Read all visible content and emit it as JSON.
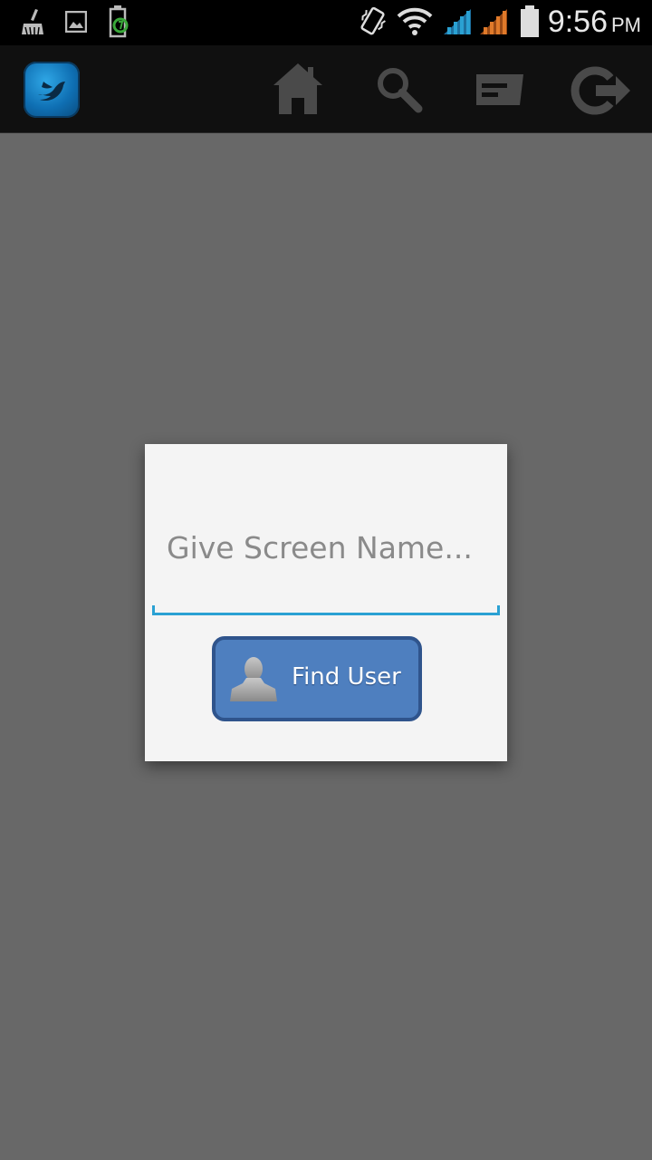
{
  "status_bar": {
    "time": "9:56",
    "ampm": "PM",
    "icons": [
      "cleaner-icon",
      "image-icon",
      "battery-charging-icon",
      "vibrate-icon",
      "wifi-icon",
      "signal-blue-icon",
      "signal-orange-icon",
      "battery-icon"
    ]
  },
  "action_bar": {
    "logo": "twitter-bird-icon",
    "actions": [
      "home-icon",
      "search-icon",
      "message-icon",
      "logout-icon"
    ]
  },
  "dialog": {
    "input_placeholder": "Give Screen Name...",
    "input_value": "",
    "button_label": "Find User",
    "colors": {
      "accent": "#2aa1d3",
      "button": "#4e7fbf",
      "button_border": "#2f548c"
    }
  }
}
